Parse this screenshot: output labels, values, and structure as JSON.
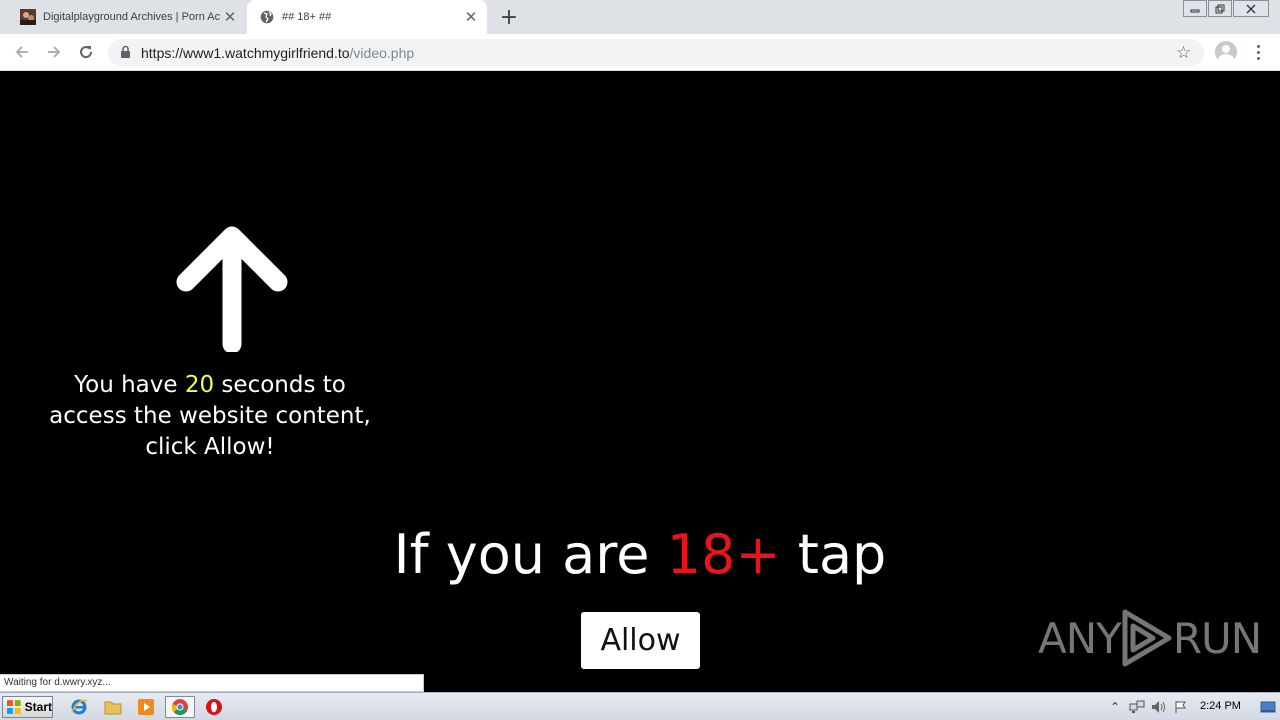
{
  "browser": {
    "tabs": [
      {
        "title": "Digitalplayground Archives | Porn Ac",
        "favicon": "site-thumbnail-icon"
      },
      {
        "title": "## 18+ ##",
        "favicon": "globe-icon"
      }
    ],
    "url_host": "https://www1.watchmygirlfriend.to",
    "url_path": "/video.php"
  },
  "page": {
    "countdown": {
      "before": "You have ",
      "seconds": "20",
      "after": " seconds to access the website content, click Allow!"
    },
    "headline": {
      "before": "If you are ",
      "highlight": "18+",
      "after": " tap"
    },
    "allow_label": "Allow",
    "watermark_left": "ANY",
    "watermark_right": "RUN",
    "status_text": "Waiting for d.wwry.xyz..."
  },
  "colors": {
    "highlight_yellow": "#f6ff3a",
    "highlight_red": "#e8141b",
    "page_background": "#000000"
  },
  "taskbar": {
    "start_label": "Start",
    "clock": "2:24 PM"
  }
}
